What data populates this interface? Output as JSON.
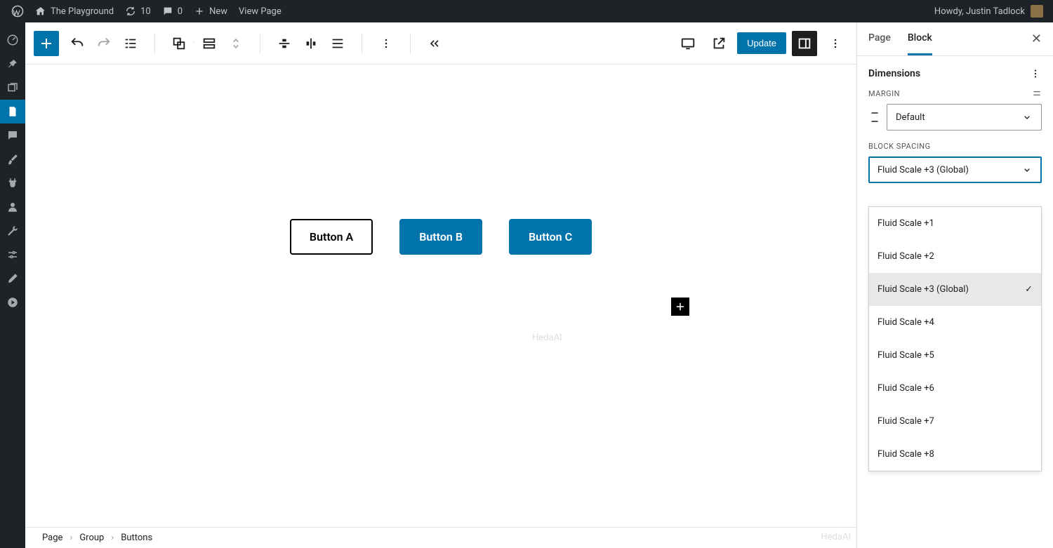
{
  "adminbar": {
    "site_name": "The Playground",
    "updates_count": "10",
    "comments_count": "0",
    "new_label": "New",
    "view_page": "View Page",
    "howdy": "Howdy, Justin Tadlock"
  },
  "header": {
    "update_label": "Update"
  },
  "canvas": {
    "buttons": [
      "Button A",
      "Button B",
      "Button C"
    ],
    "watermark": "HedaAI"
  },
  "breadcrumbs": [
    "Page",
    "Group",
    "Buttons"
  ],
  "sidebar": {
    "tabs": {
      "page": "Page",
      "block": "Block"
    },
    "dimensions_title": "Dimensions",
    "margin_label": "MARGIN",
    "margin_value": "Default",
    "spacing_label": "BLOCK SPACING",
    "spacing_value": "Fluid Scale +3 (Global)",
    "options": [
      "Fluid Scale +1",
      "Fluid Scale +2",
      "Fluid Scale +3 (Global)",
      "Fluid Scale +4",
      "Fluid Scale +5",
      "Fluid Scale +6",
      "Fluid Scale +7",
      "Fluid Scale +8"
    ],
    "selected_index": 2
  },
  "watermark_br": "HedaAI"
}
